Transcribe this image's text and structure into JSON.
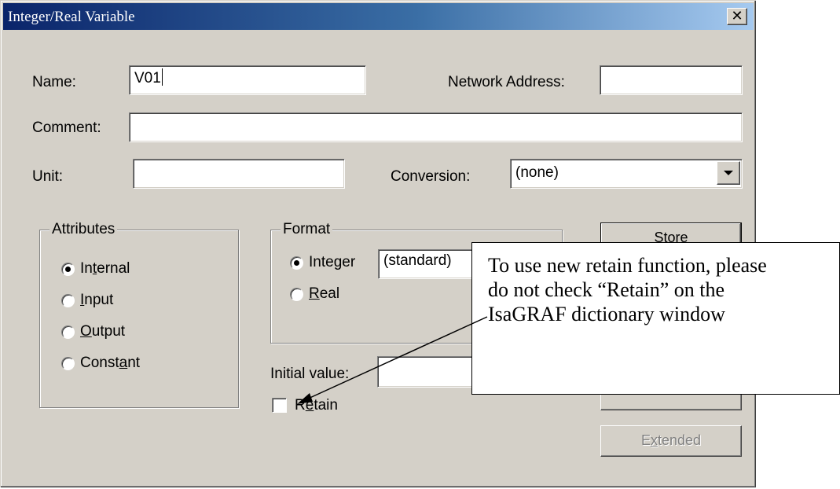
{
  "dialog": {
    "title": "Integer/Real Variable",
    "close_glyph": "✕"
  },
  "fields": {
    "name_label": "Name:",
    "name_value": "V01",
    "network_address_label": "Network Address:",
    "network_address_value": "",
    "comment_label": "Comment:",
    "comment_value": "",
    "unit_label": "Unit:",
    "unit_value": "",
    "conversion_label": "Conversion:",
    "conversion_value": "(none)"
  },
  "attributes": {
    "title": "Attributes",
    "options": [
      {
        "pre": "In",
        "ul": "t",
        "post": "ernal",
        "checked": true
      },
      {
        "pre": "",
        "ul": "I",
        "post": "nput",
        "checked": false
      },
      {
        "pre": "",
        "ul": "O",
        "post": "utput",
        "checked": false
      },
      {
        "pre": "Const",
        "ul": "a",
        "post": "nt",
        "checked": false
      }
    ]
  },
  "format": {
    "title": "Format",
    "integer": {
      "pre": "Inte",
      "ul": "g",
      "post": "er",
      "checked": true
    },
    "real": {
      "pre": "",
      "ul": "R",
      "post": "eal",
      "checked": false
    },
    "format_value": "(standard)"
  },
  "initial_value": {
    "label": "Initial value:",
    "value": ""
  },
  "retain": {
    "pre": "R",
    "ul": "e",
    "post": "tain",
    "checked": false
  },
  "buttons": {
    "store": "Store",
    "extended_pre": "E",
    "extended_ul": "x",
    "extended_post": "tended"
  },
  "callout": {
    "lines": [
      "To use new retain function, please",
      "do not check “Retain” on the",
      "IsaGRAF dictionary window"
    ]
  }
}
